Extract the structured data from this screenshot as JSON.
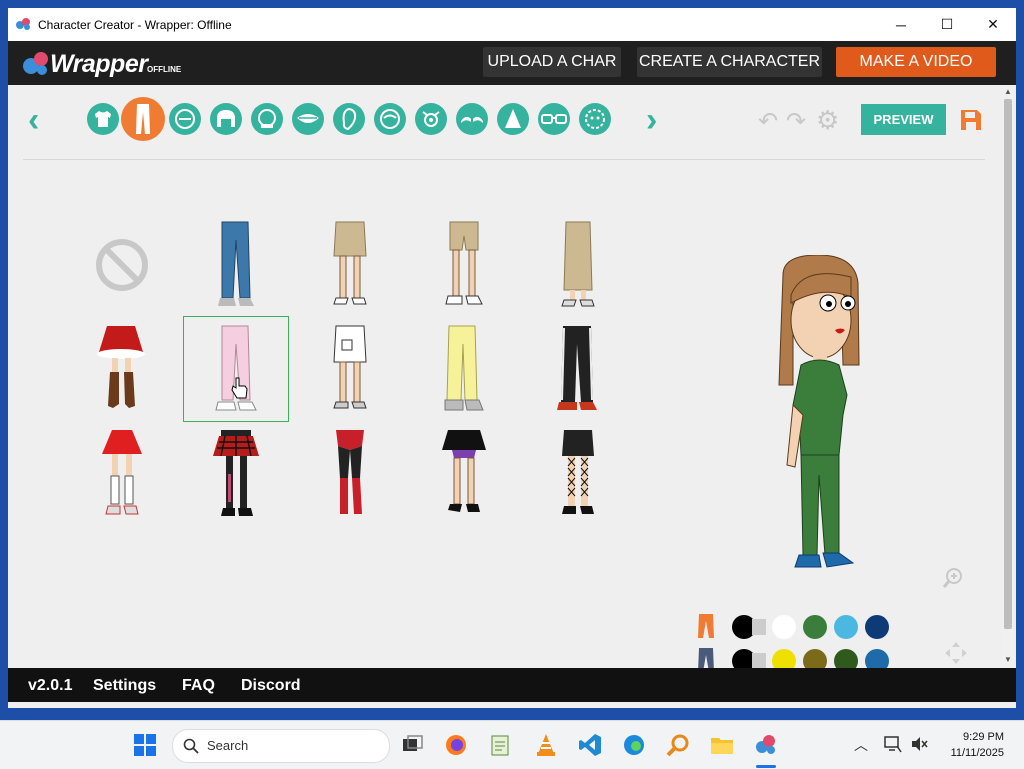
{
  "window": {
    "title": "Character Creator - Wrapper: Offline",
    "controls": {
      "minimize": "─",
      "maximize": "☐",
      "close": "✕"
    }
  },
  "topnav": {
    "logo_text": "Wrapper",
    "logo_sub": "OFFLINE",
    "buttons": {
      "upload": "UPLOAD A CHAR",
      "create": "CREATE A CHARACTER",
      "make_video": "MAKE A VIDEO"
    }
  },
  "toolbar": {
    "categories": [
      {
        "name": "shirt",
        "active": false
      },
      {
        "name": "pants",
        "active": true
      },
      {
        "name": "face",
        "active": false
      },
      {
        "name": "hair",
        "active": false
      },
      {
        "name": "head",
        "active": false
      },
      {
        "name": "mouth",
        "active": false
      },
      {
        "name": "ear",
        "active": false
      },
      {
        "name": "face-shape",
        "active": false
      },
      {
        "name": "eyes",
        "active": false
      },
      {
        "name": "eyebrows",
        "active": false
      },
      {
        "name": "nose",
        "active": false
      },
      {
        "name": "glasses",
        "active": false
      },
      {
        "name": "accessories",
        "active": false
      }
    ],
    "preview_label": "PREVIEW"
  },
  "items": [
    {
      "id": "none"
    },
    {
      "id": "jeans-blue"
    },
    {
      "id": "skirt-khaki-short"
    },
    {
      "id": "shorts-khaki"
    },
    {
      "id": "skirt-khaki-long"
    },
    {
      "id": "skirt-santa"
    },
    {
      "id": "pants-pink",
      "selected": true
    },
    {
      "id": "skirt-white"
    },
    {
      "id": "pants-yellow"
    },
    {
      "id": "pants-black-track"
    },
    {
      "id": "skirt-red"
    },
    {
      "id": "skirt-plaid-punk"
    },
    {
      "id": "tights-red-black"
    },
    {
      "id": "skirt-black-purple"
    },
    {
      "id": "skirt-black-fishnet"
    }
  ],
  "palette": {
    "row1": [
      "#000000",
      "#ffffff",
      "#3b7d3b",
      "#4ab8e0",
      "#0e3a78"
    ],
    "row2": [
      "#000000",
      "#f0e000",
      "#7a6a1a",
      "#2f5a1e",
      "#1f6aa8"
    ]
  },
  "bottombar": {
    "version": "v2.0.1",
    "settings": "Settings",
    "faq": "FAQ",
    "discord": "Discord"
  },
  "taskbar": {
    "search_placeholder": "Search",
    "time": "9:29 PM",
    "date": "11/11/2025"
  },
  "colors": {
    "accent_teal": "#36b39f",
    "accent_orange": "#f07c34",
    "make_video_orange": "#e05a1c",
    "topnav_bg": "#1f1f1f"
  }
}
